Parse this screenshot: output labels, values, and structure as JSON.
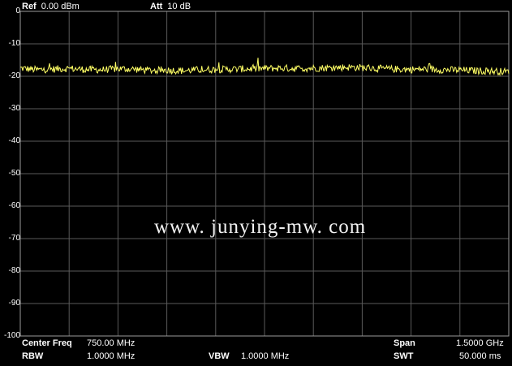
{
  "header": {
    "ref_label": "Ref",
    "ref_value": "0.00 dBm",
    "att_label": "Att",
    "att_value": "10 dB"
  },
  "footer": {
    "center_freq_label": "Center Freq",
    "center_freq_value": "750.00 MHz",
    "span_label": "Span",
    "span_value": "1.5000 GHz",
    "rbw_label": "RBW",
    "rbw_value": "1.0000 MHz",
    "vbw_label": "VBW",
    "vbw_value": "1.0000 MHz",
    "swt_label": "SWT",
    "swt_value": "50.000 ms"
  },
  "watermark": "www. junying-mw. com",
  "colors": {
    "background": "#000000",
    "grid": "#5a5a5a",
    "frame": "#9a9a9a",
    "trace": "#ffff66",
    "text": "#ffffff"
  },
  "chart_data": {
    "type": "line",
    "title": "",
    "xlabel": "",
    "ylabel": "",
    "xlim": [
      0,
      1500
    ],
    "ylim": [
      -100,
      0
    ],
    "x_unit": "MHz",
    "y_unit": "dBm",
    "yticks": [
      "0",
      "-10",
      "-20",
      "-30",
      "-40",
      "-50",
      "-60",
      "-70",
      "-80",
      "-90",
      "-100"
    ],
    "grid": true,
    "legend": "none",
    "series": [
      {
        "x": [
          0,
          50,
          100,
          150,
          200,
          250,
          300,
          350,
          400,
          450,
          500,
          550,
          600,
          650,
          700,
          750,
          800,
          850,
          900,
          950,
          1000,
          1050,
          1100,
          1150,
          1200,
          1250,
          1300,
          1350,
          1400,
          1450,
          1500
        ],
        "values": [
          -17.5,
          -18.0,
          -17.8,
          -17.6,
          -17.9,
          -18.0,
          -17.7,
          -17.8,
          -18.2,
          -18.1,
          -18.3,
          -18.0,
          -17.9,
          -17.8,
          -17.7,
          -17.6,
          -17.5,
          -17.6,
          -17.5,
          -17.4,
          -17.2,
          -17.3,
          -17.6,
          -17.8,
          -17.9,
          -17.8,
          -18.0,
          -18.1,
          -18.3,
          -18.4,
          -18.6
        ]
      }
    ]
  }
}
